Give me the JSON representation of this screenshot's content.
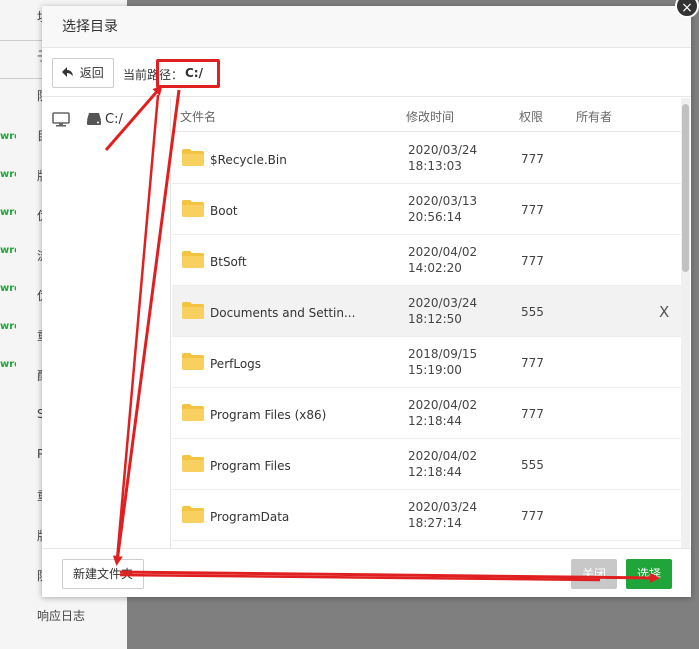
{
  "background": {
    "menu_items": [
      "址",
      "子",
      "防",
      "目",
      "版",
      "伪",
      "流",
      "伪",
      "重",
      "配",
      "S",
      "P",
      "重",
      "版",
      "防"
    ],
    "row_tags": [
      "wro",
      "wro",
      "wro",
      "wro",
      "wro",
      "wro",
      "wro"
    ],
    "footer_item": "响应日志"
  },
  "dialog": {
    "title": "选择目录",
    "close_glyph": "×",
    "toolbar": {
      "back_label": "返回",
      "path_label": "当前路径：",
      "path_value": "C:/"
    },
    "side": {
      "drive_label": "C:/"
    },
    "table": {
      "headers": [
        "文件名",
        "修改时间",
        "权限",
        "所有者"
      ],
      "rows": [
        {
          "name": "$Recycle.Bin",
          "date": "2020/03/24",
          "time": "18:13:03",
          "perm": "777"
        },
        {
          "name": "Boot",
          "date": "2020/03/13",
          "time": "20:56:14",
          "perm": "777"
        },
        {
          "name": "BtSoft",
          "date": "2020/04/02",
          "time": "14:02:20",
          "perm": "777"
        },
        {
          "name": "Documents and Settin...",
          "date": "2020/03/24",
          "time": "18:12:50",
          "perm": "555",
          "mark": "X"
        },
        {
          "name": "PerfLogs",
          "date": "2018/09/15",
          "time": "15:19:00",
          "perm": "777"
        },
        {
          "name": "Program Files (x86)",
          "date": "2020/04/02",
          "time": "12:18:44",
          "perm": "777"
        },
        {
          "name": "Program Files",
          "date": "2020/04/02",
          "time": "12:18:44",
          "perm": "555"
        },
        {
          "name": "ProgramData",
          "date": "2020/03/24",
          "time": "18:27:14",
          "perm": "777"
        }
      ]
    },
    "footer": {
      "new_folder_label": "新建文件夹",
      "close_label": "关闭",
      "select_label": "选择"
    }
  },
  "colors": {
    "accent_green": "#20a53a",
    "annotation_red": "#e02020",
    "folder_yellow": "#f5c342"
  },
  "icons": {
    "monitor": "monitor-icon",
    "drive": "hard-drive-icon",
    "folder": "folder-icon",
    "back": "back-arrow-icon"
  }
}
